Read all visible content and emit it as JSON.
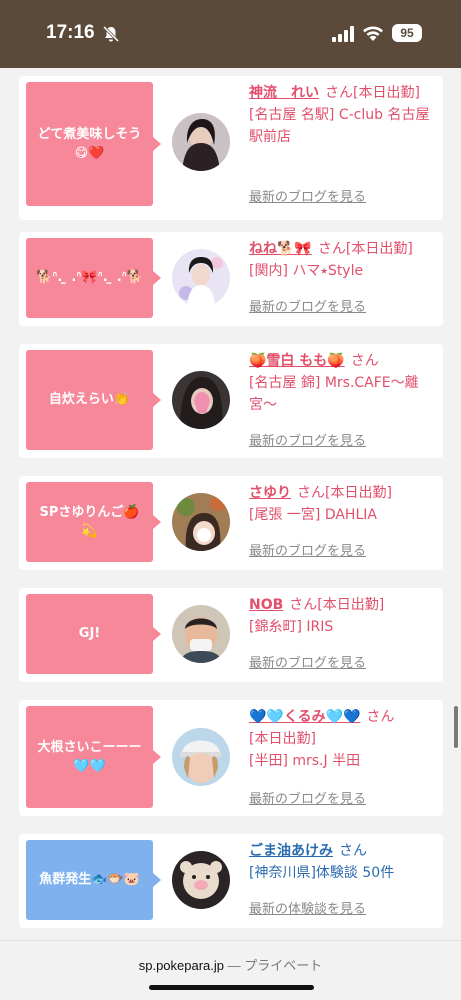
{
  "status_bar": {
    "time": "17:16",
    "battery": "95"
  },
  "cards": [
    {
      "bubble": "どて煮美味しそう😋❤️",
      "bubble_color": "#f6889a",
      "name": "神流　れい",
      "suffix": "さん",
      "status": "[本日出勤]",
      "area": "[名古屋 名駅] C-club 名古屋駅前店",
      "link": "最新のブログを見る",
      "theme": "pink"
    },
    {
      "bubble": "🐕ᐢ. ̫ .ᐢ🎀ᐢ. ̫ .ᐢ🐕",
      "bubble_color": "#f6889a",
      "name": "ねね🐕🎀",
      "suffix": "さん",
      "status": "[本日出勤]",
      "area": "[関内] ハマ⭑Style",
      "link": "最新のブログを見る",
      "theme": "pink"
    },
    {
      "bubble": "自炊えらい👏",
      "bubble_color": "#f6889a",
      "name": "🍑雪白 もも🍑",
      "suffix": "さん",
      "status": "",
      "area": "[名古屋 錦] Mrs.CAFE〜離宮〜",
      "link": "最新のブログを見る",
      "theme": "pink"
    },
    {
      "bubble": "SPさゆりんご🍎💫",
      "bubble_color": "#f6889a",
      "name": "さゆり",
      "suffix": "さん",
      "status": "[本日出勤]",
      "area": "[尾張 一宮] DAHLIA",
      "link": "最新のブログを見る",
      "theme": "pink"
    },
    {
      "bubble": "GJ!",
      "bubble_color": "#f6889a",
      "name": "NOB",
      "suffix": "さん",
      "status": "[本日出勤]",
      "area": "[錦糸町] IRIS",
      "link": "最新のブログを見る",
      "theme": "pink"
    },
    {
      "bubble": "大根さいこーーー🩵🩵",
      "bubble_color": "#f6889a",
      "name": "💙🩵くるみ🩵💙",
      "suffix": "さん",
      "status": "[本日出勤]",
      "area": "[半田] mrs.J 半田",
      "link": "最新のブログを見る",
      "theme": "pink"
    },
    {
      "bubble": "魚群発生🐟🐡🐷",
      "bubble_color": "#7fb1ee",
      "name": "ごま油あけみ",
      "suffix": "さん",
      "status": "",
      "area": "[神奈川県]体験談 50件",
      "link": "最新の体験談を見る",
      "theme": "blue"
    }
  ],
  "url_bar": {
    "domain": "sp.pokepara.jp",
    "separator": " — ",
    "mode": "プライベート"
  }
}
